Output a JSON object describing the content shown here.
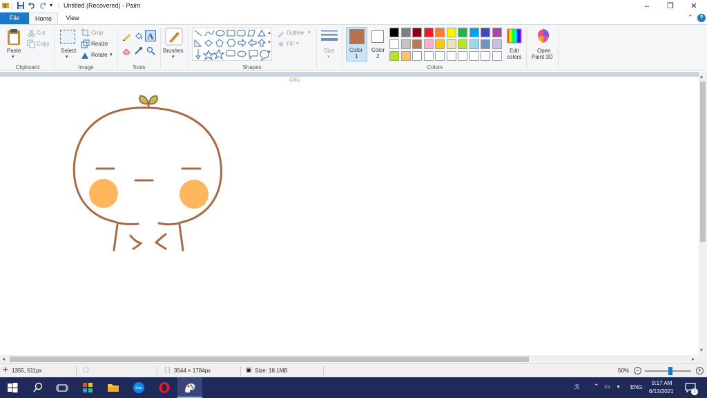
{
  "window": {
    "title": "Untitled (Recovered) - Paint",
    "minimize": "–",
    "restore": "❐",
    "close": "✕",
    "help": "?"
  },
  "tabs": [
    "File",
    "Home",
    "View"
  ],
  "ribbon": {
    "clipboard": {
      "label": "Clipboard",
      "paste": "Paste",
      "cut": "Cut",
      "copy": "Copy"
    },
    "image": {
      "label": "Image",
      "select": "Select",
      "crop": "Crop",
      "resize": "Resize",
      "rotate": "Rotate"
    },
    "tools": {
      "label": "Tools"
    },
    "brushes": {
      "label": "Brushes"
    },
    "shapes": {
      "label": "Shapes",
      "outline": "Outline",
      "fill": "Fill"
    },
    "size": {
      "label": "Size"
    },
    "colors": {
      "label": "Colors",
      "color1": "Color",
      "color1_num": "1",
      "color2": "Color",
      "color2_num": "2",
      "color1_value": "#b5734f",
      "color2_value": "#ffffff",
      "edit_colors_1": "Edit",
      "edit_colors_2": "colors",
      "open_paint3d_1": "Open",
      "open_paint3d_2": "Paint 3D",
      "palette_row1": [
        "#000000",
        "#7f7f7f",
        "#880015",
        "#ed1c24",
        "#ff7f27",
        "#fff200",
        "#22b14c",
        "#00a2e8",
        "#3f48cc",
        "#a349a4"
      ],
      "palette_row2": [
        "#ffffff",
        "#c3c3c3",
        "#b97a57",
        "#ffaec9",
        "#ffc90e",
        "#efe4b0",
        "#b5e61d",
        "#99d9ea",
        "#7092be",
        "#c8bfe7"
      ],
      "palette_row3": [
        "#b5e61d",
        "#ffc36a",
        "#ffffff",
        "#ffffff",
        "#ffffff",
        "#ffffff",
        "#ffffff",
        "#ffffff",
        "#ffffff",
        "#ffffff"
      ]
    }
  },
  "canvas": {
    "watermark": "©Kv"
  },
  "status": {
    "cursor": "1355, 511px",
    "dimensions": "3544 × 1784px",
    "size": "Size: 18.1MB",
    "zoom": "50%",
    "zoom_fraction": 0.55
  },
  "taskbar": {
    "lang": "ENG",
    "time": "9:17 AM",
    "date": "6/13/2021",
    "notif_count": "1"
  }
}
